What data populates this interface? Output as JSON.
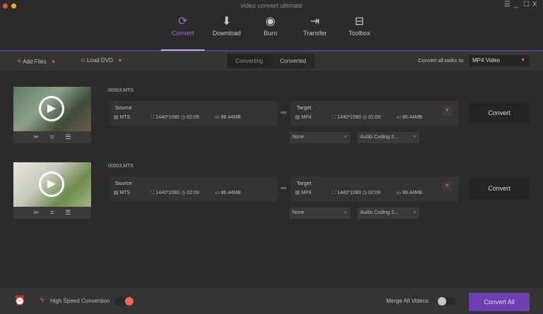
{
  "window": {
    "title": "video convert ultimate",
    "controls": [
      "☰",
      "_",
      "☐",
      "X"
    ]
  },
  "nav": [
    {
      "label": "Convert",
      "icon": "convert-icon"
    },
    {
      "label": "Download",
      "icon": "download-icon"
    },
    {
      "label": "Burn",
      "icon": "burn-icon"
    },
    {
      "label": "Transfer",
      "icon": "transfer-icon"
    },
    {
      "label": "Toolbox",
      "icon": "toolbox-icon"
    }
  ],
  "toolbar": {
    "add_files": "Add Files",
    "load_dvd": "Load DVD",
    "tab_converting": "Converting",
    "tab_converted": "Converted",
    "convert_all_label": "Convert all tasks to:",
    "convert_all_value": "MP4 Video"
  },
  "tasks": [
    {
      "filename": "00003.MTS",
      "source": {
        "label": "Source",
        "format": "MTS",
        "resolution": "1440*1080",
        "duration": "02:09",
        "size": "86.44MB"
      },
      "target": {
        "label": "Target",
        "format": "MP4",
        "resolution": "1440*1080",
        "duration": "02:09",
        "size": "86.44MB"
      },
      "subtitle": "None",
      "audio": "Audio Coding 3...",
      "convert": "Convert"
    },
    {
      "filename": "00003.MTS",
      "source": {
        "label": "Source",
        "format": "MTS",
        "resolution": "1440*1080",
        "duration": "02:09",
        "size": "86.44MB"
      },
      "target": {
        "label": "Target",
        "format": "MP4",
        "resolution": "1440*1080",
        "duration": "02:09",
        "size": "86.44MB"
      },
      "subtitle": "None",
      "audio": "Audio Coding 3...",
      "convert": "Convert"
    }
  ],
  "bottom": {
    "high_speed": "High Speed Conversion",
    "high_speed_on": true,
    "merge": "Merge All Videos",
    "merge_on": false,
    "convert_all": "Convert All"
  },
  "colors": {
    "accent": "#6c40b0",
    "red": "#e46b57"
  }
}
